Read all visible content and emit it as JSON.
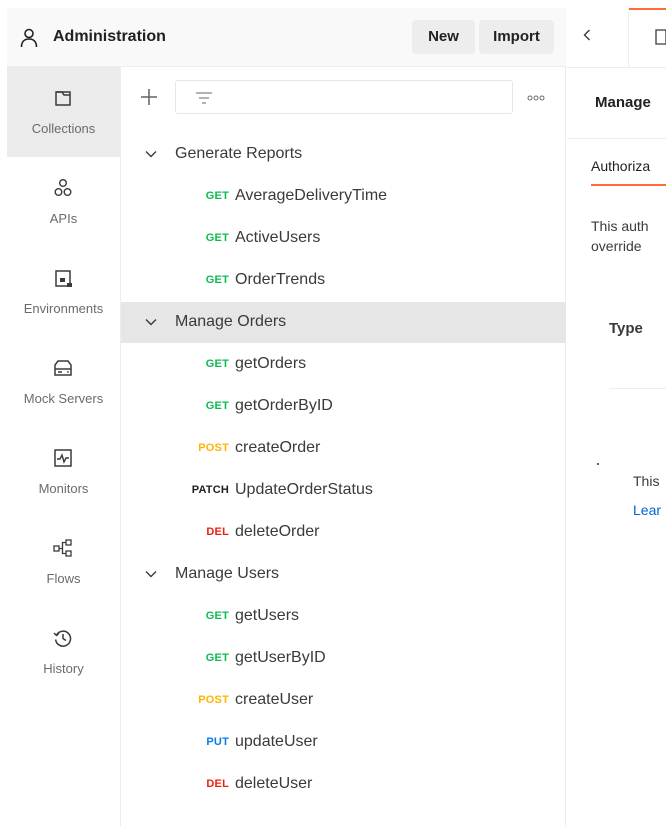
{
  "workspace": {
    "title": "Administration",
    "new_label": "New",
    "import_label": "Import"
  },
  "sidebar": {
    "items": [
      {
        "label": "Collections",
        "icon": "collections-icon",
        "active": true
      },
      {
        "label": "APIs",
        "icon": "apis-icon",
        "active": false
      },
      {
        "label": "Environments",
        "icon": "environments-icon",
        "active": false
      },
      {
        "label": "Mock Servers",
        "icon": "mock-servers-icon",
        "active": false
      },
      {
        "label": "Monitors",
        "icon": "monitors-icon",
        "active": false
      },
      {
        "label": "Flows",
        "icon": "flows-icon",
        "active": false
      },
      {
        "label": "History",
        "icon": "history-icon",
        "active": false
      }
    ]
  },
  "method_colors": {
    "GET": "#0cbb52",
    "POST": "#ffb400",
    "PATCH": "#212121",
    "DEL": "#eb2013",
    "PUT": "#097bed"
  },
  "tree": {
    "folders": [
      {
        "name": "Generate Reports",
        "selected": false,
        "requests": [
          {
            "method": "GET",
            "name": "AverageDeliveryTime"
          },
          {
            "method": "GET",
            "name": "ActiveUsers"
          },
          {
            "method": "GET",
            "name": "OrderTrends"
          }
        ]
      },
      {
        "name": "Manage Orders",
        "selected": true,
        "requests": [
          {
            "method": "GET",
            "name": "getOrders"
          },
          {
            "method": "GET",
            "name": "getOrderByID"
          },
          {
            "method": "POST",
            "name": "createOrder"
          },
          {
            "method": "PATCH",
            "name": "UpdateOrderStatus"
          },
          {
            "method": "DEL",
            "name": "deleteOrder"
          }
        ]
      },
      {
        "name": "Manage Users",
        "selected": false,
        "requests": [
          {
            "method": "GET",
            "name": "getUsers"
          },
          {
            "method": "GET",
            "name": "getUserByID"
          },
          {
            "method": "POST",
            "name": "createUser"
          },
          {
            "method": "PUT",
            "name": "updateUser"
          },
          {
            "method": "DEL",
            "name": "deleteUser"
          }
        ]
      }
    ]
  },
  "right_panel": {
    "title": "Manage",
    "auth_tab": "Authoriza",
    "desc_line1": "This auth",
    "desc_line2": "override",
    "type_label": "Type",
    "note_text": "This",
    "note_link": "Lear"
  }
}
